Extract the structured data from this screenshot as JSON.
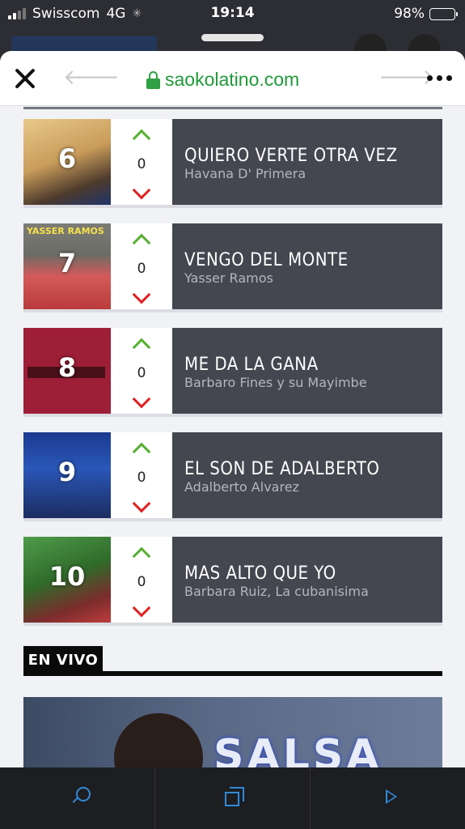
{
  "status_bar": {
    "carrier": "Swisscom",
    "network": "4G",
    "time": "19:14",
    "battery": "98%"
  },
  "browser": {
    "url": "saokolatino.com"
  },
  "chart_rows": [
    {
      "rank": "6",
      "votes": "0",
      "title": "QUIERO VERTE OTRA VEZ",
      "artist": "Havana D' Primera"
    },
    {
      "rank": "7",
      "votes": "0",
      "title": "VENGO DEL MONTE",
      "artist": "Yasser Ramos"
    },
    {
      "rank": "8",
      "votes": "0",
      "title": "ME DA LA GANA",
      "artist": "Barbaro Fines y su Mayimbe"
    },
    {
      "rank": "9",
      "votes": "0",
      "title": "EL SON DE ADALBERTO",
      "artist": "Adalberto Alvarez"
    },
    {
      "rank": "10",
      "votes": "0",
      "title": "MAS ALTO QUE YO",
      "artist": "Barbara Ruiz, La cubanisima"
    }
  ],
  "cover_text": {
    "row2": "YASSER RAMOS"
  },
  "en_vivo": {
    "label": "EN VIVO",
    "video_text": "SALSA"
  },
  "colors": {
    "url_green": "#1f9a3a",
    "row_bg": "#444650",
    "up_arrow": "#55b030",
    "down_arrow": "#e02020",
    "toolbar_icon": "#2f8ad8"
  },
  "icons": [
    "close-icon",
    "back-arrow-icon",
    "forward-arrow-icon",
    "lock-icon",
    "more-icon",
    "vote-up-icon",
    "vote-down-icon",
    "search-icon",
    "tabs-icon",
    "play-icon"
  ]
}
